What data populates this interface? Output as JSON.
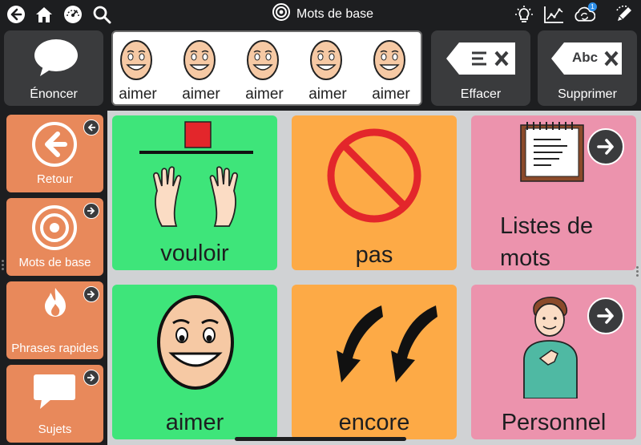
{
  "topbar": {
    "title": "Mots de base",
    "left_icons": [
      "back-icon",
      "home-icon",
      "dashboard-icon",
      "search-icon"
    ],
    "right_icons": [
      "lightbulb-icon",
      "chart-icon",
      "sync-icon",
      "edit-icon"
    ],
    "sync_badge": "1"
  },
  "toolbar": {
    "speak_label": "Énoncer",
    "clear_label": "Effacer",
    "delete_label": "Supprimer",
    "delete_icon_text": "Abc"
  },
  "message_bar": {
    "words": [
      "aimer",
      "aimer",
      "aimer",
      "aimer",
      "aimer"
    ]
  },
  "sidebar": {
    "items": [
      {
        "label": "Retour"
      },
      {
        "label": "Mots de base"
      },
      {
        "label": "Phrases rapides"
      },
      {
        "label": "Sujets"
      }
    ]
  },
  "grid": {
    "cells": [
      {
        "label": "vouloir",
        "color": "#3ee57a"
      },
      {
        "label": "pas",
        "color": "#fdaa46"
      },
      {
        "label": "Listes de mots",
        "line1": "Listes de",
        "line2": "mots",
        "color": "#ec93ad"
      },
      {
        "label": "aimer",
        "color": "#3ee57a"
      },
      {
        "label": "encore",
        "color": "#fdaa46"
      },
      {
        "label": "Personnel",
        "color": "#ec93ad"
      }
    ]
  },
  "colors": {
    "background": "#1d1e20",
    "button_dark": "#3a3b3d",
    "sidebar_orange": "#e8895b",
    "green": "#3ee57a",
    "orange": "#fdaa46",
    "pink": "#ec93ad",
    "grid_bg": "#d0d2d4"
  }
}
